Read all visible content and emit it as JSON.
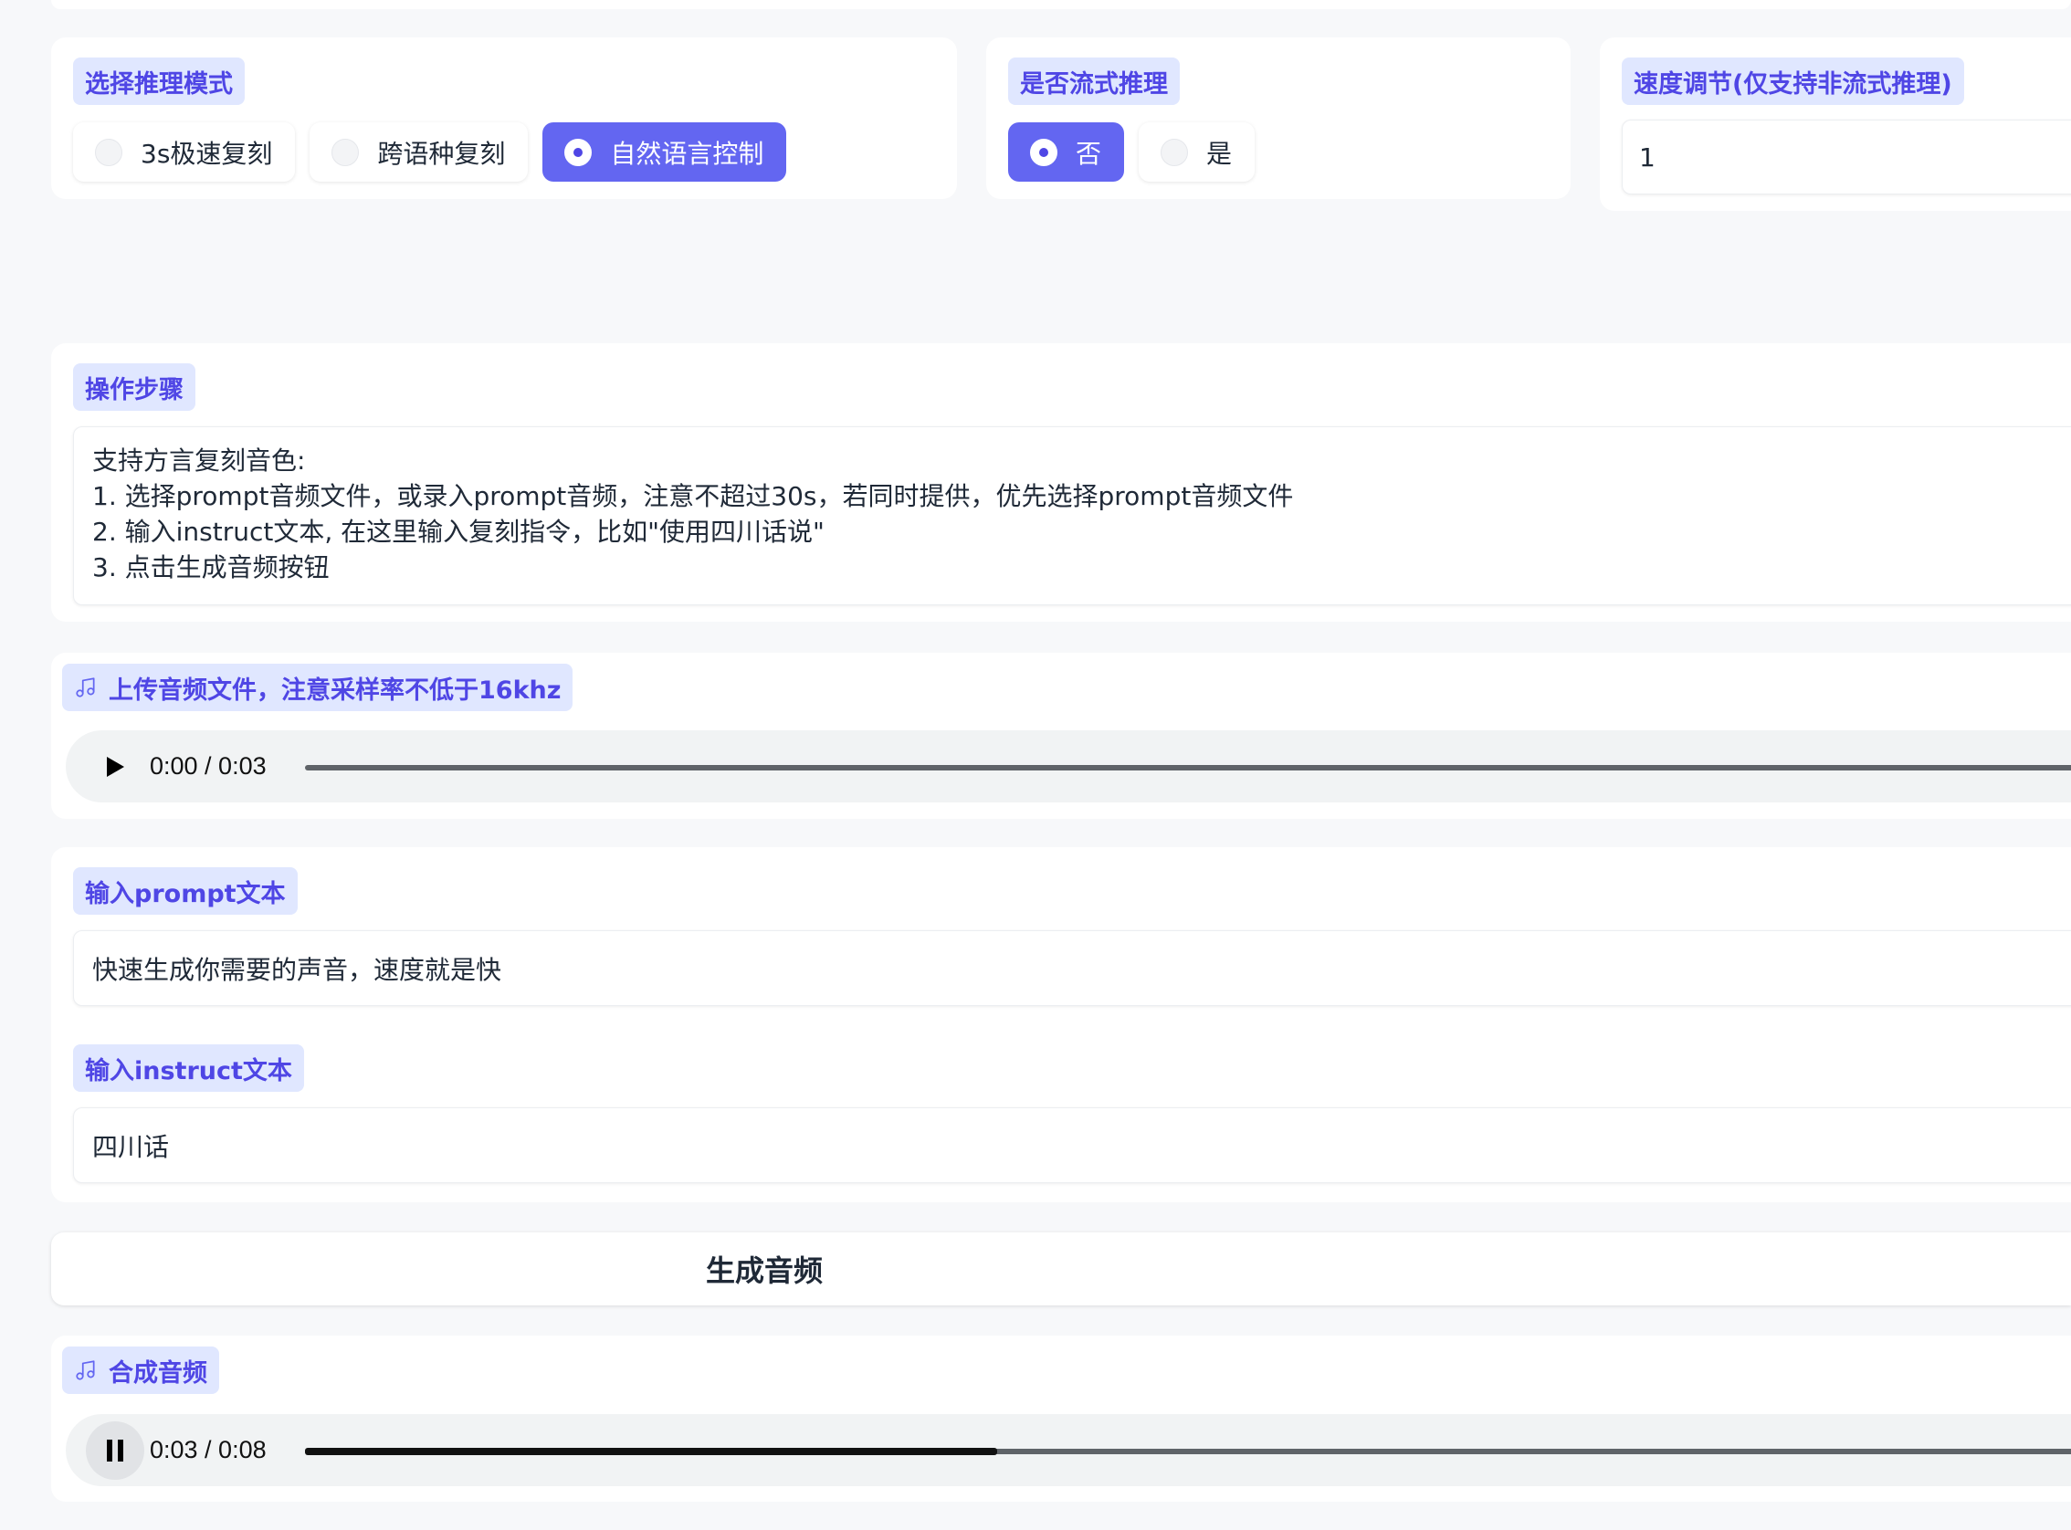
{
  "mode": {
    "label": "选择推理模式",
    "options": [
      "3s极速复刻",
      "跨语种复刻",
      "自然语言控制"
    ],
    "selected": "自然语言控制"
  },
  "stream": {
    "label": "是否流式推理",
    "options": [
      "否",
      "是"
    ],
    "selected": "否"
  },
  "speed": {
    "label": "速度调节(仅支持非流式推理)",
    "value": "1"
  },
  "steps": {
    "label": "操作步骤",
    "lines": [
      "支持方言复刻音色:",
      "1. 选择prompt音频文件，或录入prompt音频，注意不超过30s，若同时提供，优先选择prompt音频文件",
      "2. 输入instruct文本, 在这里输入复刻指令，比如\"使用四川话说\"",
      "3. 点击生成音频按钮"
    ]
  },
  "upload_audio": {
    "label": "上传音频文件，注意采样率不低于16khz",
    "icon": "music-note-icon",
    "time": "0:00 / 0:03",
    "progress": 0
  },
  "prompt_text": {
    "label": "输入prompt文本",
    "value": "快速生成你需要的声音，速度就是快"
  },
  "instruct_text": {
    "label": "输入instruct文本",
    "value": "四川话"
  },
  "generate_button": {
    "label": "生成音频"
  },
  "output_audio": {
    "label": "合成音频",
    "icon": "music-note-icon",
    "time": "0:03 / 0:08",
    "progress": 0.375
  },
  "colors": {
    "accent": "#6366f1",
    "label_bg": "#e0e7ff",
    "label_text": "#4f46e5"
  }
}
